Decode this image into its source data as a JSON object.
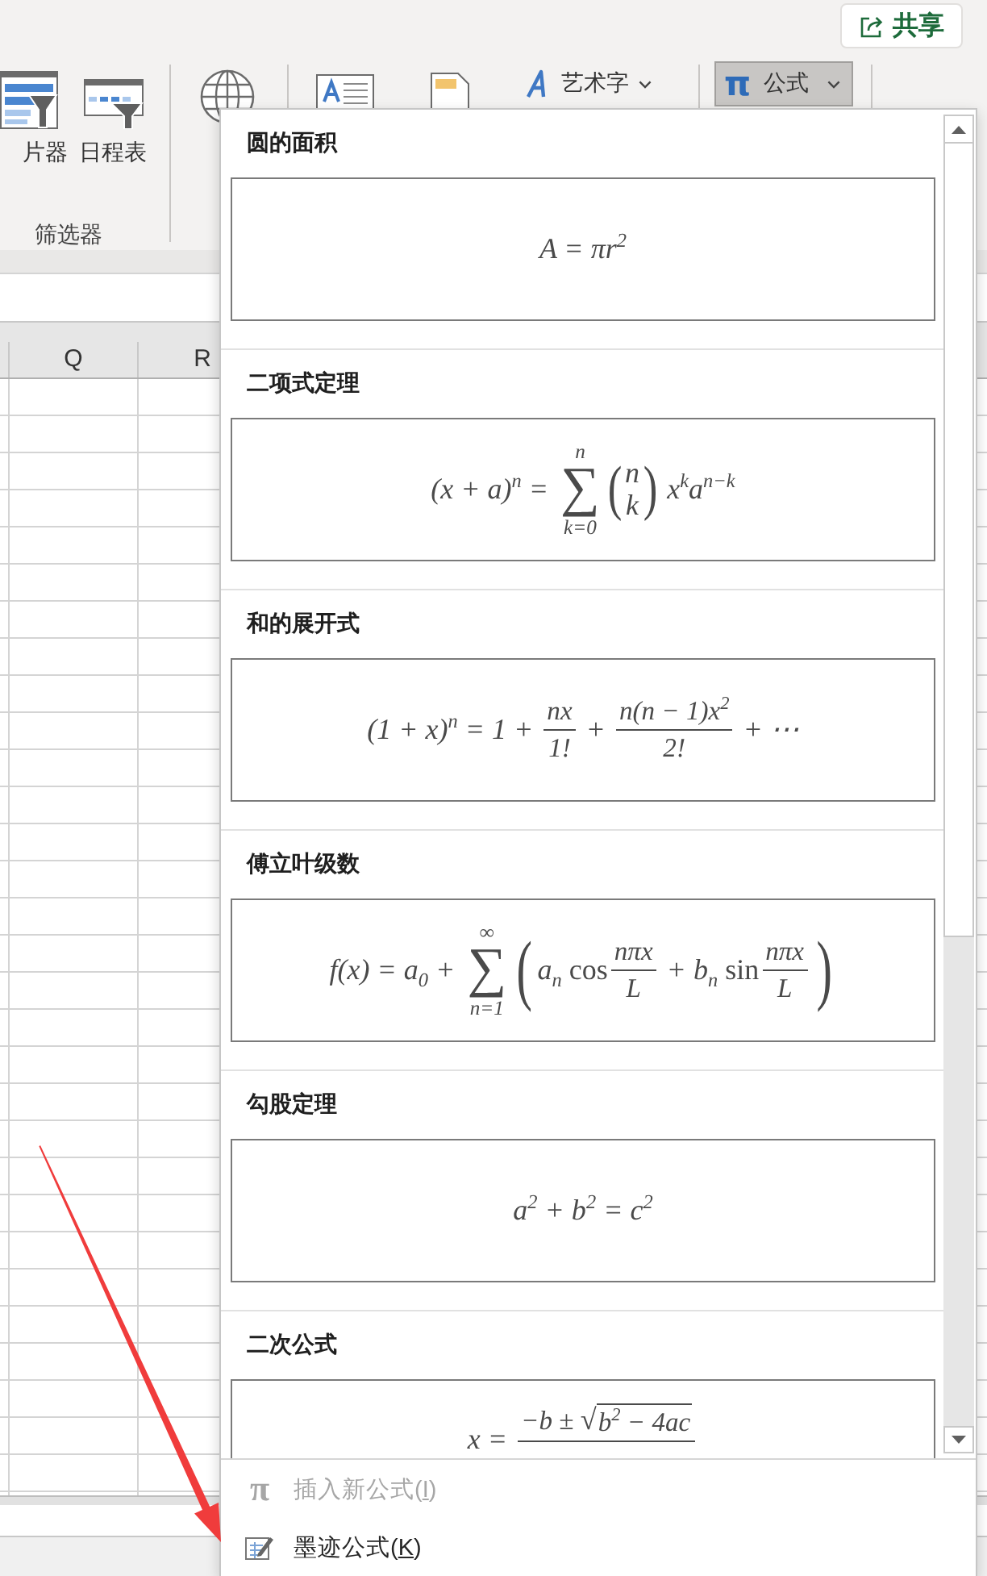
{
  "share_button": {
    "label": "共享"
  },
  "ribbon": {
    "groups": [
      {
        "label": "筛选器",
        "buttons": [
          {
            "kind": "slicer",
            "label": "片器"
          },
          {
            "kind": "timeline",
            "label": "日程表"
          }
        ]
      },
      {
        "buttons": [
          {
            "kind": "globe"
          }
        ]
      },
      {
        "buttons": [
          {
            "kind": "text_box"
          },
          {
            "kind": "header_footer"
          },
          {
            "kind": "wordart",
            "label": "艺术字"
          }
        ]
      },
      {
        "buttons": [
          {
            "kind": "equation",
            "symbol": "π",
            "label": "公式",
            "expanded": true
          }
        ]
      }
    ]
  },
  "sheet": {
    "column_headers": [
      "Q",
      "R"
    ]
  },
  "equation_menu": {
    "gallery": [
      {
        "title": "圆的面积",
        "formula": [
          {
            "kind": "text",
            "text": "A = πr$^{2}$"
          }
        ]
      },
      {
        "title": "二项式定理",
        "formula": [
          {
            "kind": "text",
            "text": "(x + a)$^{n}$ = "
          },
          {
            "kind": "sum",
            "symbol": "∑",
            "upper": "n",
            "lower": "k=0"
          },
          {
            "kind": "binom",
            "open": "(",
            "close": ")",
            "top": "n",
            "bottom": "k"
          },
          {
            "kind": "text",
            "text": " x$^{k}$a$^{n−k}$"
          }
        ]
      },
      {
        "title": "和的展开式",
        "formula": [
          {
            "kind": "text",
            "text": "(1 + x)$^{n}$ = 1 + "
          },
          {
            "kind": "frac",
            "num": [
              {
                "kind": "text",
                "text": "nx"
              }
            ],
            "den": [
              {
                "kind": "text",
                "text": "1!"
              }
            ]
          },
          {
            "kind": "text",
            "text": " + "
          },
          {
            "kind": "frac",
            "num": [
              {
                "kind": "text",
                "text": "n(n − 1)x$^{2}$"
              }
            ],
            "den": [
              {
                "kind": "text",
                "text": "2!"
              }
            ]
          },
          {
            "kind": "text",
            "text": " + ⋯"
          }
        ]
      },
      {
        "title": "傅立叶级数",
        "formula": [
          {
            "kind": "text",
            "text": "f(x) = a$_{0}$ + "
          },
          {
            "kind": "sum",
            "symbol": "∑",
            "upper": "∞",
            "lower": "n=1"
          },
          {
            "kind": "fence",
            "open": "(",
            "close": ")",
            "items": [
              {
                "kind": "text",
                "text": "a$_{n}$ "
              },
              {
                "kind": "fn",
                "text": "cos"
              },
              {
                "kind": "frac",
                "num": [
                  {
                    "kind": "text",
                    "text": "nπx"
                  }
                ],
                "den": [
                  {
                    "kind": "text",
                    "text": "L"
                  }
                ]
              },
              {
                "kind": "text",
                "text": " + b$_{n}$ "
              },
              {
                "kind": "fn",
                "text": "sin"
              },
              {
                "kind": "frac",
                "num": [
                  {
                    "kind": "text",
                    "text": "nπx"
                  }
                ],
                "den": [
                  {
                    "kind": "text",
                    "text": "L"
                  }
                ]
              }
            ]
          }
        ]
      },
      {
        "title": "勾股定理",
        "formula": [
          {
            "kind": "text",
            "text": "a$^{2}$ + b$^{2}$ = c$^{2}$"
          }
        ]
      },
      {
        "title": "二次公式",
        "formula": [
          {
            "kind": "text",
            "text": "x = "
          },
          {
            "kind": "frac",
            "num": [
              {
                "kind": "text",
                "text": "−b ± "
              },
              {
                "kind": "sqrt",
                "symbol": "√",
                "body": [
                  {
                    "kind": "text",
                    "text": "b$^{2}$ − 4ac"
                  }
                ]
              }
            ]
          }
        ]
      }
    ],
    "commands": [
      {
        "kind": "insert",
        "symbol": "π",
        "text": "插入新公式(",
        "access_key": "I",
        "text_end": ")",
        "disabled": true
      },
      {
        "kind": "ink",
        "text": "墨迹公式(",
        "access_key": "K",
        "text_end": ")",
        "disabled": false
      }
    ]
  }
}
